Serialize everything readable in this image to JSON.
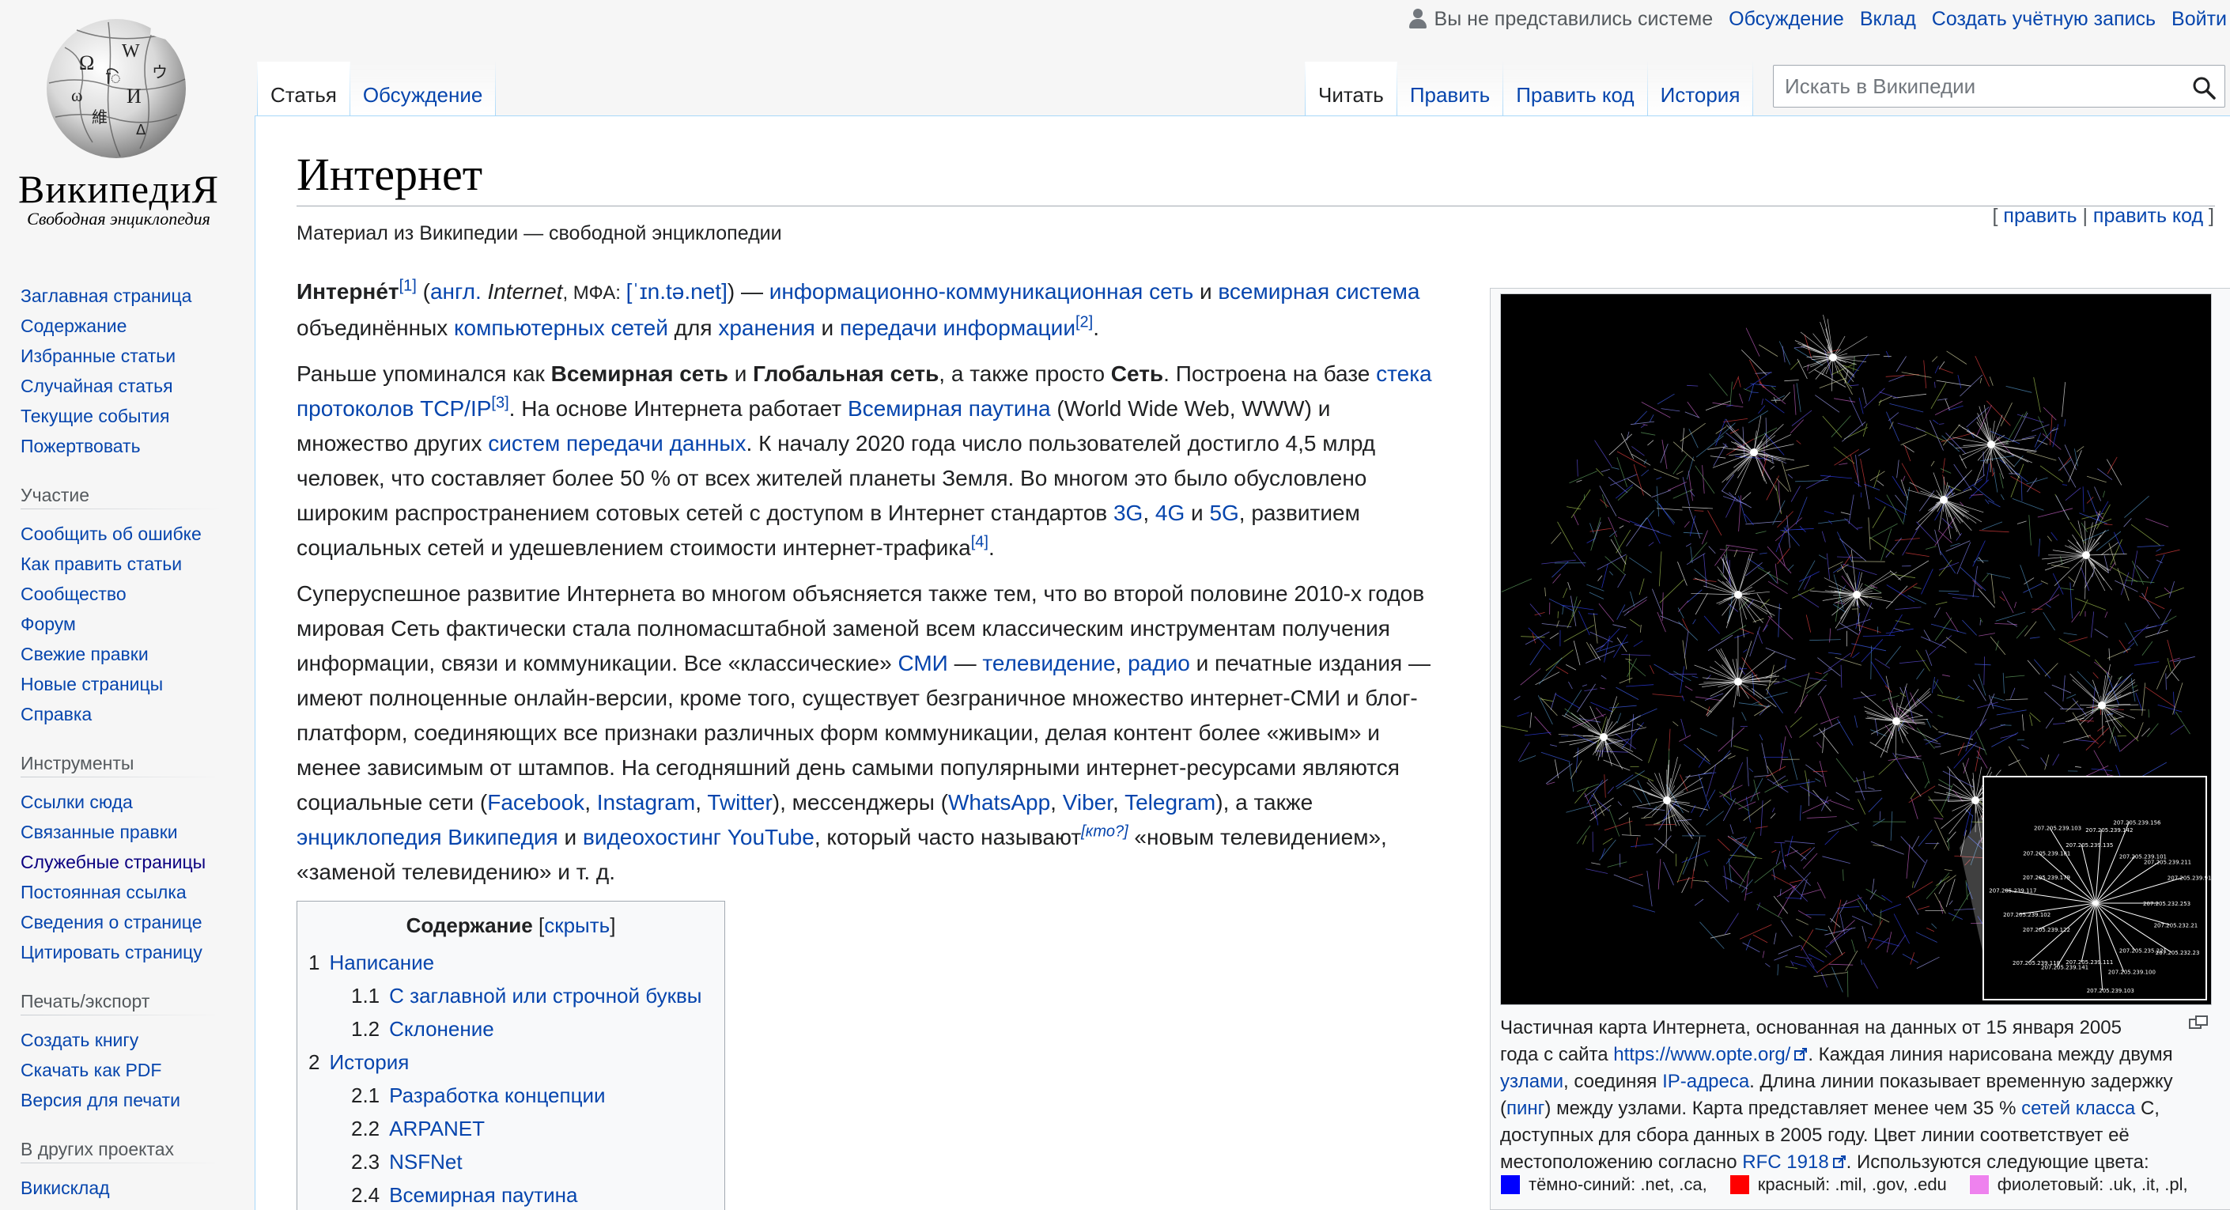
{
  "personal": {
    "anon_label": "Вы не представились системе",
    "talk": "Обсуждение",
    "contributions": "Вклад",
    "create_account": "Создать учётную запись",
    "login": "Войти"
  },
  "logo": {
    "wordmark": "ВикипедиЯ",
    "tagline": "Свободная энциклопедия"
  },
  "sidebar": {
    "navigation": [
      "Заглавная страница",
      "Содержание",
      "Избранные статьи",
      "Случайная статья",
      "Текущие события",
      "Пожертвовать"
    ],
    "participation_title": "Участие",
    "participation": [
      "Сообщить об ошибке",
      "Как править статьи",
      "Сообщество",
      "Форум",
      "Свежие правки",
      "Новые страницы",
      "Справка"
    ],
    "tools_title": "Инструменты",
    "tools": [
      "Ссылки сюда",
      "Связанные правки",
      "Служебные страницы",
      "Постоянная ссылка",
      "Сведения о странице",
      "Цитировать страницу"
    ],
    "print_title": "Печать/экспорт",
    "print": [
      "Создать книгу",
      "Скачать как PDF",
      "Версия для печати"
    ],
    "projects_title": "В других проектах",
    "projects": [
      "Викисклад"
    ]
  },
  "tabs": {
    "article": "Статья",
    "discussion": "Обсуждение",
    "read": "Читать",
    "edit": "Править",
    "edit_source": "Править код",
    "history": "История"
  },
  "search": {
    "placeholder": "Искать в Википедии"
  },
  "article": {
    "title": "Интернет",
    "site_sub": "Материал из Википедии — свободной энциклопедии",
    "edit_links": {
      "open": "[",
      "edit": "править",
      "sep": "|",
      "edit_source": "править код",
      "close": "]"
    }
  },
  "p1": {
    "bold": "Интерне́т",
    "ref1": "[1]",
    "open": " (",
    "lang": "англ.",
    "word": " Internet",
    "ipa_label": ", МФА: ",
    "ipa": "[ˈɪn.tə.net]",
    "close": ") — ",
    "l1": "информационно-коммуникационная сеть",
    "and": " и ",
    "l2": "всемирная система",
    "line2_start": "объединённых ",
    "l3": "компьютерных сетей",
    "for": " для ",
    "l4": "хранения",
    "and2": " и ",
    "l5": "передачи информации",
    "ref2": "[2]",
    "end": "."
  },
  "p2": {
    "t1": "Раньше упоминался как ",
    "b1": "Всемирная сеть",
    "t2": " и ",
    "b2": "Глобальная сеть",
    "t3": ", а также просто ",
    "b3": "Сеть",
    "t4": ". Построена на базе ",
    "l1": "стека",
    "l1b": "протоколов TCP/IP",
    "ref3": "[3]",
    "t5": ". На основе Интернета работает ",
    "l2": "Всемирная паутина",
    "t6": " (World Wide Web, WWW) и",
    "t7": "множество других ",
    "l3": "систем передачи данных",
    "t8": ". К началу 2020 года число пользователей достигло 4,5 млрд",
    "t9": "человек, что составляет более 50 % от всех жителей планеты Земля. Во многом это было обусловлено",
    "t10": "широким распространением сотовых сетей с доступом в Интернет стандартов ",
    "l4": "3G",
    "c1": ", ",
    "l5": "4G",
    "t11": " и ",
    "l6": "5G",
    "t12": ", развитием",
    "t13": "социальных сетей и удешевлением стоимости интернет-трафика",
    "ref4": "[4]",
    "end": "."
  },
  "p3": {
    "line1": "Суперуспешное развитие Интернета во многом объясняется также тем, что во второй половине 2010-х годов",
    "line2": "мировая Сеть фактически стала полномасштабной заменой всем классическим инструментам получения",
    "line3a": "информации, связи и коммуникации. Все «классические» ",
    "smi": "СМИ",
    "dash": " — ",
    "tv": "телевидение",
    "comma": ", ",
    "radio": "радио",
    "line3b": " и печатные издания —",
    "line4": "имеют полноценные онлайн-версии, кроме того, существует безграничное множество интернет-СМИ и блог-",
    "line5": "платформ, соединяющих все признаки различных форм коммуникации, делая контент более «живым» и",
    "line6": "менее зависимым от штампов. На сегодняшний день самыми популярными интернет-ресурсами являются",
    "line7a": "социальные сети (",
    "fb": "Facebook",
    "c1": ", ",
    "ig": "Instagram",
    "c2": ", ",
    "tw": "Twitter",
    "line7b": "), мессенджеры (",
    "wa": "WhatsApp",
    "c3": ", ",
    "vb": "Viber",
    "c4": ", ",
    "tg": "Telegram",
    "line7c": "), а также",
    "wiki": "энциклопедия Википедия",
    "and": " и ",
    "yt": "видеохостинг YouTube",
    "line8a": ", который часто называют",
    "who": "[кто?]",
    "line8b": " «новым телевидением»,",
    "line9": "«заменой телевидению» и т. д."
  },
  "toc": {
    "title": "Содержание",
    "hide_open": " [",
    "hide": "скрыть",
    "hide_close": "]",
    "items": [
      {
        "num": "1",
        "label": "Написание",
        "level": 1
      },
      {
        "num": "1.1",
        "label": "С заглавной или строчной буквы",
        "level": 2
      },
      {
        "num": "1.2",
        "label": "Склонение",
        "level": 2
      },
      {
        "num": "2",
        "label": "История",
        "level": 1
      },
      {
        "num": "2.1",
        "label": "Разработка концепции",
        "level": 2
      },
      {
        "num": "2.2",
        "label": "ARPANET",
        "level": 2
      },
      {
        "num": "2.3",
        "label": "NSFNet",
        "level": 2
      },
      {
        "num": "2.4",
        "label": "Всемирная паутина",
        "level": 2
      }
    ]
  },
  "thumb": {
    "inset_labels": [
      "207.205.232.253",
      "207.205.232.21",
      "207.205.232.23",
      "207.205.235.221",
      "207.205.239.100",
      "207.205.239.103",
      "207.205.239.111",
      "207.205.239.141",
      "207.205.239.118",
      "207.205.239.122",
      "207.205.239.102",
      "207.205.239.117",
      "207.205.239.179",
      "207.205.239.181",
      "207.205.239.103",
      "207.205.239.135",
      "207.205.239.142",
      "207.205.239.156",
      "207.205.239.101",
      "207.205.239.211",
      "207.205.239.91"
    ],
    "caption": {
      "t1": "Частичная карта Интернета, основанная на данных от 15 января 2005",
      "t2": "года с сайта ",
      "l1": "https://www.opte.org/",
      "t3": ". Каждая линия нарисована между двумя",
      "l2": "узлами",
      "t4": ", соединяя ",
      "l3": "IP-адреса",
      "t5": ". Длина линии показывает временную задержку",
      "t6": "(",
      "l4": "пинг",
      "t7": ") между узлами. Карта представляет менее чем 35 % ",
      "l5": "сетей класса",
      "t8": " C,",
      "t9": "доступных для сбора данных в 2005 году. Цвет линии соответствует её",
      "t10": "местоположению согласно ",
      "l6": "RFC 1918",
      "t11": ". Используются следующие цвета:"
    },
    "legend": [
      {
        "color": "#0000ff",
        "label": "тёмно-синий: .net, .ca,"
      },
      {
        "color": "#ff0000",
        "label": "красный: .mil, .gov, .edu"
      },
      {
        "color": "#ee82ee",
        "label": "фиолетовый: .uk, .it, .pl,"
      }
    ]
  }
}
